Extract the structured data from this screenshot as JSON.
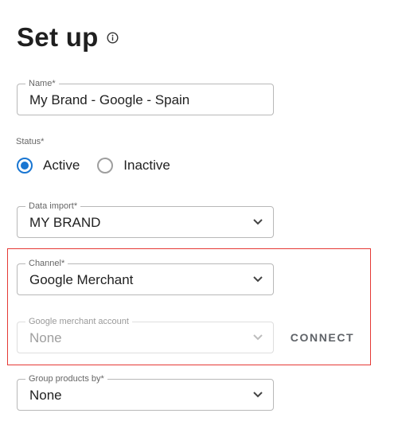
{
  "page": {
    "title": "Set up"
  },
  "name_field": {
    "label": "Name*",
    "value": "My Brand - Google - Spain"
  },
  "status": {
    "label": "Status*",
    "options": [
      {
        "label": "Active",
        "selected": true
      },
      {
        "label": "Inactive",
        "selected": false
      }
    ]
  },
  "data_import": {
    "label": "Data import*",
    "value": "MY BRAND"
  },
  "channel": {
    "label": "Channel*",
    "value": "Google Merchant"
  },
  "merchant_account": {
    "label": "Google merchant account",
    "value": "None",
    "disabled": true
  },
  "connect": {
    "label": "CONNECT"
  },
  "group_products": {
    "label": "Group products by*",
    "value": "None"
  },
  "colors": {
    "accent": "#1976d2",
    "highlight": "#e53935",
    "disabled_text": "#9e9e9e"
  }
}
